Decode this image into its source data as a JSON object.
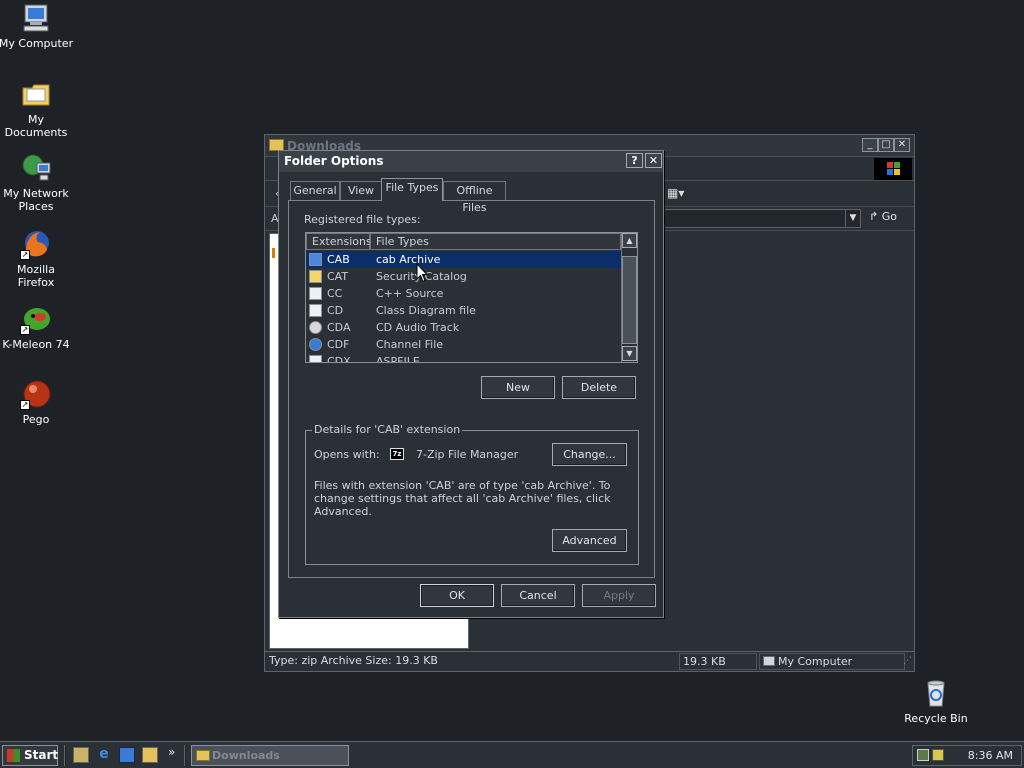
{
  "desktop": {
    "icons": [
      {
        "label": "My Computer",
        "icon": "computer-icon"
      },
      {
        "label": "My Documents",
        "icon": "folder-icon"
      },
      {
        "label": "My Network Places",
        "icon": "network-icon"
      },
      {
        "label": "Mozilla Firefox",
        "icon": "firefox-icon"
      },
      {
        "label": "K-Meleon 74",
        "icon": "kmeleon-icon"
      },
      {
        "label": "Pego",
        "icon": "pego-icon"
      },
      {
        "label": "Recycle Bin",
        "icon": "recycle-bin-icon"
      }
    ]
  },
  "explorer": {
    "title": "Downloads",
    "address_letter": "A",
    "go_label": "Go",
    "status": {
      "info": "Type: zip Archive Size: 19.3 KB",
      "size": "19.3 KB",
      "location": "My Computer"
    }
  },
  "dialog": {
    "title": "Folder Options",
    "help_label": "?",
    "close_label": "✕",
    "tabs": [
      {
        "label": "General",
        "active": false
      },
      {
        "label": "View",
        "active": false
      },
      {
        "label": "File Types",
        "active": true
      },
      {
        "label": "Offline Files",
        "active": false
      }
    ],
    "registered_label": "Registered file types:",
    "columns": [
      "Extensions",
      "File Types"
    ],
    "rows": [
      {
        "ext": "CAB",
        "type": "cab Archive",
        "selected": true
      },
      {
        "ext": "CAT",
        "type": "Security Catalog",
        "selected": false
      },
      {
        "ext": "CC",
        "type": "C++ Source",
        "selected": false
      },
      {
        "ext": "CD",
        "type": "Class Diagram file",
        "selected": false
      },
      {
        "ext": "CDA",
        "type": "CD Audio Track",
        "selected": false
      },
      {
        "ext": "CDF",
        "type": "Channel File",
        "selected": false
      },
      {
        "ext": "CDX",
        "type": "ASPFILE",
        "selected": false
      }
    ],
    "new_label": "New",
    "delete_label": "Delete",
    "details_title": "Details for 'CAB' extension",
    "opens_with_label": "Opens with:",
    "opens_with_app": "7-Zip File Manager",
    "app_icon_text": "7z",
    "change_label": "Change...",
    "description": "Files with extension 'CAB' are of type 'cab Archive'.  To change settings that affect all 'cab Archive' files, click Advanced.",
    "advanced_label": "Advanced",
    "ok_label": "OK",
    "cancel_label": "Cancel",
    "apply_label": "Apply"
  },
  "taskbar": {
    "start_label": "Start",
    "task_label": "Downloads",
    "clock": "8:36 AM",
    "more_label": "»"
  }
}
